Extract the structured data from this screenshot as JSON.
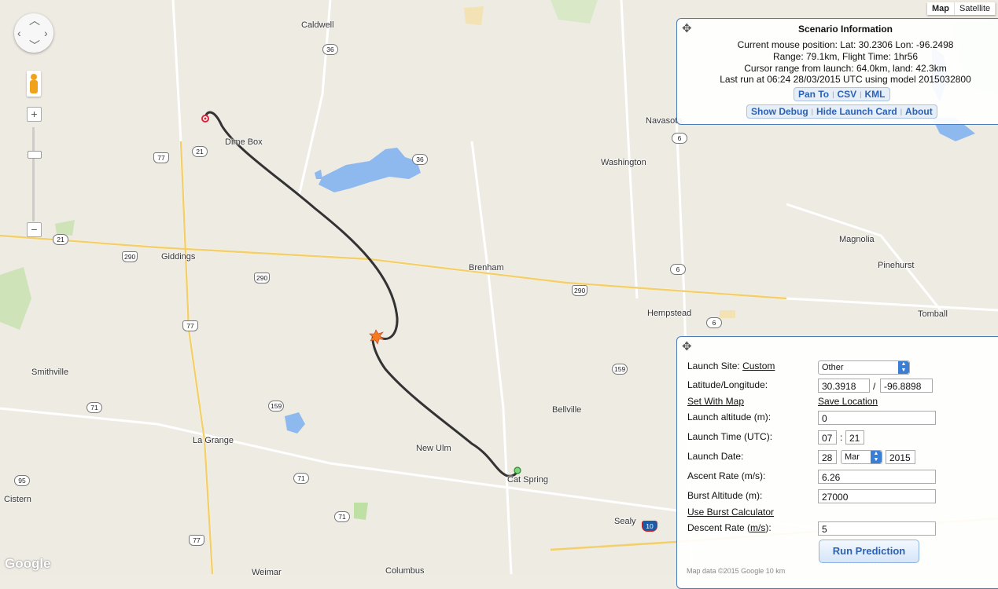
{
  "map": {
    "places": [
      {
        "name": "Caldwell"
      },
      {
        "name": "Dime Box"
      },
      {
        "name": "Giddings"
      },
      {
        "name": "Smithville"
      },
      {
        "name": "La Grange"
      },
      {
        "name": "Cistern"
      },
      {
        "name": "Weimar"
      },
      {
        "name": "Columbus"
      },
      {
        "name": "New Ulm"
      },
      {
        "name": "Cat Spring"
      },
      {
        "name": "Bellville"
      },
      {
        "name": "Sealy"
      },
      {
        "name": "Brenham"
      },
      {
        "name": "Washington"
      },
      {
        "name": "Navasota"
      },
      {
        "name": "Hempstead"
      },
      {
        "name": "Magnolia"
      },
      {
        "name": "Pinehurst"
      },
      {
        "name": "Tomball"
      }
    ],
    "shields": [
      {
        "label": "36",
        "type": "state"
      },
      {
        "label": "21",
        "type": "state"
      },
      {
        "label": "77",
        "type": "us"
      },
      {
        "label": "36",
        "type": "state"
      },
      {
        "label": "21",
        "type": "state"
      },
      {
        "label": "290",
        "type": "us"
      },
      {
        "label": "290",
        "type": "us"
      },
      {
        "label": "77",
        "type": "us"
      },
      {
        "label": "71",
        "type": "state"
      },
      {
        "label": "159",
        "type": "state"
      },
      {
        "label": "95",
        "type": "state"
      },
      {
        "label": "71",
        "type": "state"
      },
      {
        "label": "71",
        "type": "state"
      },
      {
        "label": "77",
        "type": "us"
      },
      {
        "label": "159",
        "type": "state"
      },
      {
        "label": "290",
        "type": "us"
      },
      {
        "label": "6",
        "type": "state"
      },
      {
        "label": "6",
        "type": "state"
      },
      {
        "label": "6",
        "type": "state"
      },
      {
        "label": "10",
        "type": "interstate"
      }
    ],
    "map_type": {
      "map": "Map",
      "satellite": "Satellite"
    },
    "google": "Google"
  },
  "scenario": {
    "title": "Scenario Information",
    "mouse_position": "Current mouse position: Lat: 30.2306 Lon: -96.2498",
    "range_flight": "Range: 79.1km, Flight Time: 1hr56",
    "cursor_range": "Cursor range from launch: 64.0km, land: 42.3km",
    "last_run": "Last run at 06:24 28/03/2015 UTC using model 2015032800",
    "pan_to": "Pan To",
    "csv": "CSV",
    "kml": "KML",
    "show_debug": "Show Debug",
    "hide_launch_card": "Hide Launch Card",
    "about": "About"
  },
  "launch": {
    "site_label": "Launch Site:",
    "site_link": "Custom",
    "site_select": "Other",
    "latlon_label": "Latitude/Longitude:",
    "lat": "30.3918",
    "slash": "/",
    "lon": "-96.8898",
    "set_with_map": "Set With Map",
    "save_location": "Save Location",
    "altitude_label": "Launch altitude (m):",
    "altitude": "0",
    "time_label": "Launch Time (UTC):",
    "hour": "07",
    "colon": ":",
    "minute": "21",
    "date_label": "Launch Date:",
    "day": "28",
    "month": "Mar",
    "year": "2015",
    "ascent_label": "Ascent Rate (m/s):",
    "ascent": "6.26",
    "burst_label": "Burst Altitude (m):",
    "burst": "27000",
    "burst_calc": "Use Burst Calculator",
    "descent_label_pre": "Descent Rate (",
    "descent_label_unit": "m/s",
    "descent_label_post": "):",
    "descent": "5",
    "run": "Run Prediction"
  },
  "footnote": "Map data ©2015 Google   10 km"
}
